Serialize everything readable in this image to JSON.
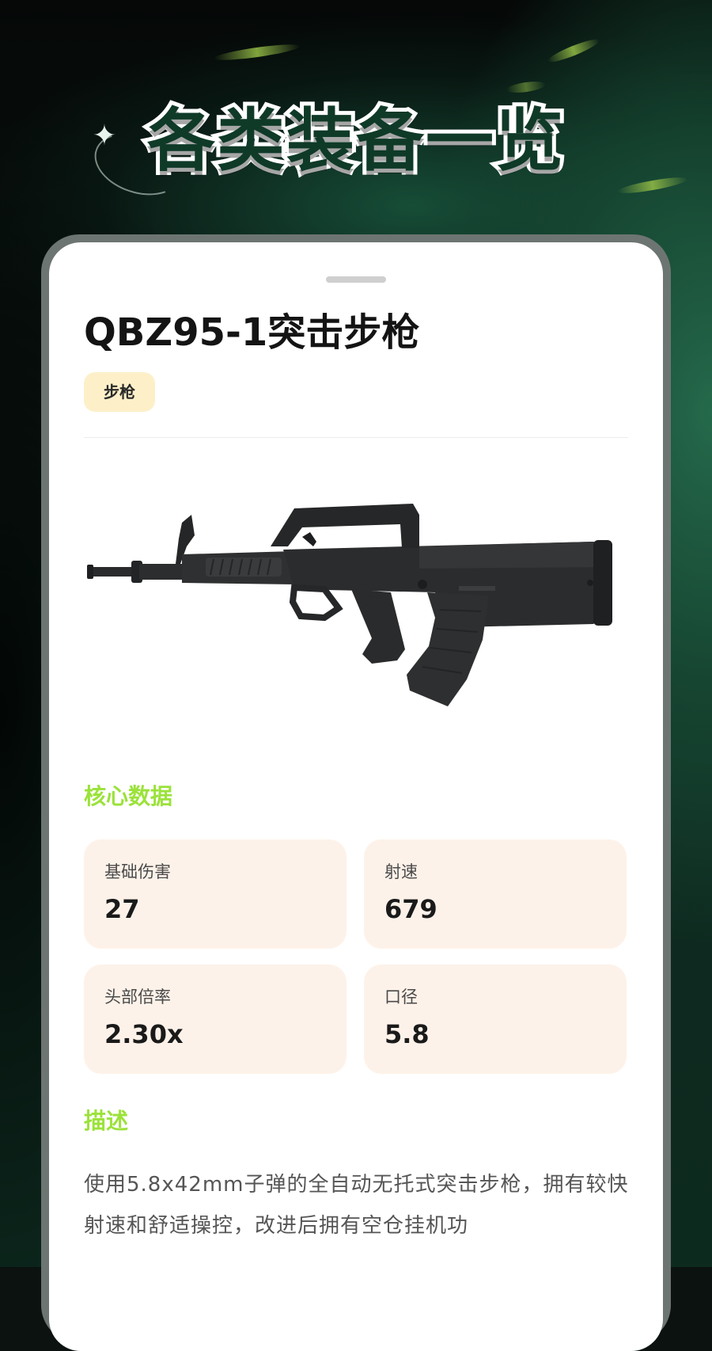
{
  "banner": {
    "title": "各类装备一览"
  },
  "weapon": {
    "name": "QBZ95-1突击步枪",
    "tag": "步枪",
    "image_icon": "rifle-image"
  },
  "core_data": {
    "heading": "核心数据",
    "stats": [
      {
        "label": "基础伤害",
        "value": "27"
      },
      {
        "label": "射速",
        "value": "679"
      },
      {
        "label": "头部倍率",
        "value": "2.30x"
      },
      {
        "label": "口径",
        "value": "5.8"
      }
    ]
  },
  "description": {
    "heading": "描述",
    "text": "使用5.8x42mm子弹的全自动无托式突击步枪，拥有较快射速和舒适操控，改进后拥有空仓挂机功"
  },
  "colors": {
    "accent_green": "#9be23a",
    "stat_bg": "#fdf2e9",
    "tag_bg": "#fdf0c9"
  }
}
